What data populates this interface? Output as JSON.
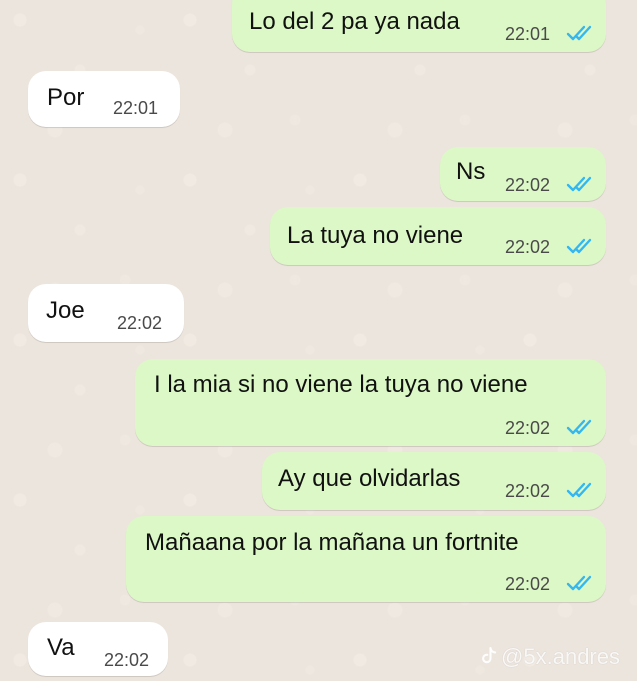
{
  "messages": [
    {
      "text": "Lo del 2 pa ya nada",
      "time": "22:01",
      "direction": "out",
      "status": "read"
    },
    {
      "text": "Por",
      "time": "22:01",
      "direction": "in"
    },
    {
      "text": "Ns",
      "time": "22:02",
      "direction": "out",
      "status": "read"
    },
    {
      "text": "La tuya no viene",
      "time": "22:02",
      "direction": "out",
      "status": "read"
    },
    {
      "text": "Joe",
      "time": "22:02",
      "direction": "in"
    },
    {
      "text": "I la mia si no viene la tuya no viene",
      "time": "22:02",
      "direction": "out",
      "status": "read"
    },
    {
      "text": "Ay que olvidarlas",
      "time": "22:02",
      "direction": "out",
      "status": "read"
    },
    {
      "text": "Mañaana por la mañana un fortnite",
      "time": "22:02",
      "direction": "out",
      "status": "read"
    },
    {
      "text": "Va",
      "time": "22:02",
      "direction": "in"
    }
  ],
  "watermark": {
    "text": "@5x.andres",
    "icon": "tiktok-icon"
  },
  "colors": {
    "background": "#ece5dd",
    "outgoing_bubble": "#dcf8c6",
    "incoming_bubble": "#ffffff",
    "read_tick": "#34b7f1"
  }
}
